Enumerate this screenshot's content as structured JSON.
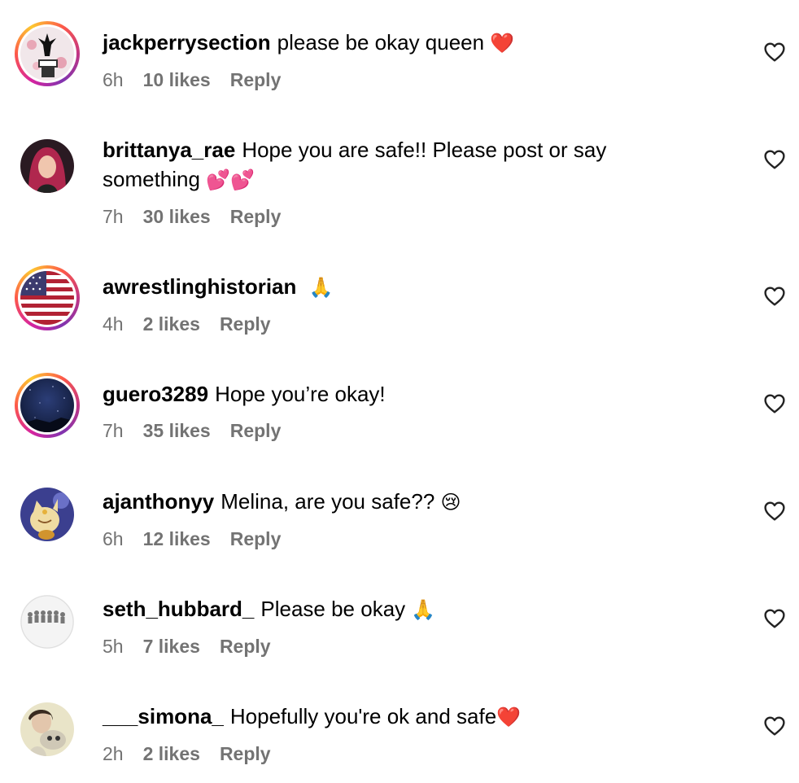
{
  "comments": [
    {
      "username": "jackperrysection",
      "text": "please be okay queen",
      "emoji": "❤️",
      "time": "6h",
      "likes": "10 likes",
      "reply": "Reply",
      "avatar_style": "ring",
      "avatar_icon": "wrestler-photo-avatar"
    },
    {
      "username": "brittanya_rae",
      "text": "Hope you are safe!! Please post or say",
      "text_line2": "something",
      "emoji": "💕💕",
      "time": "7h",
      "likes": "30 likes",
      "reply": "Reply",
      "avatar_style": "plain",
      "avatar_icon": "person-photo-avatar"
    },
    {
      "username": "awrestlinghistorian",
      "text": "",
      "emoji": "🙏",
      "time": "4h",
      "likes": "2 likes",
      "reply": "Reply",
      "avatar_style": "ring",
      "avatar_icon": "us-flag-avatar"
    },
    {
      "username": "guero3289",
      "text": "Hope you’re okay!",
      "emoji": "",
      "time": "7h",
      "likes": "35 likes",
      "reply": "Reply",
      "avatar_style": "ring",
      "avatar_icon": "night-sky-avatar"
    },
    {
      "username": "ajanthonyy",
      "text": "Melina, are you safe??",
      "emoji": "😢",
      "time": "6h",
      "likes": "12 likes",
      "reply": "Reply",
      "avatar_style": "plain",
      "avatar_icon": "cartoon-cat-avatar"
    },
    {
      "username": "seth_hubbard_",
      "text": "Please be okay",
      "emoji": "🙏",
      "time": "5h",
      "likes": "7 likes",
      "reply": "Reply",
      "avatar_style": "plain",
      "avatar_icon": "group-photo-avatar"
    },
    {
      "username": "___simona_",
      "text": "Hopefully you're ok and safe",
      "emoji": "❤️",
      "time": "2h",
      "likes": "2 likes",
      "reply": "Reply",
      "avatar_style": "plain",
      "avatar_icon": "person-photo-avatar"
    }
  ],
  "colors": {
    "text": "#000000",
    "meta": "#737373",
    "ring_start": "#d6249f",
    "ring_end": "#fdc830"
  }
}
